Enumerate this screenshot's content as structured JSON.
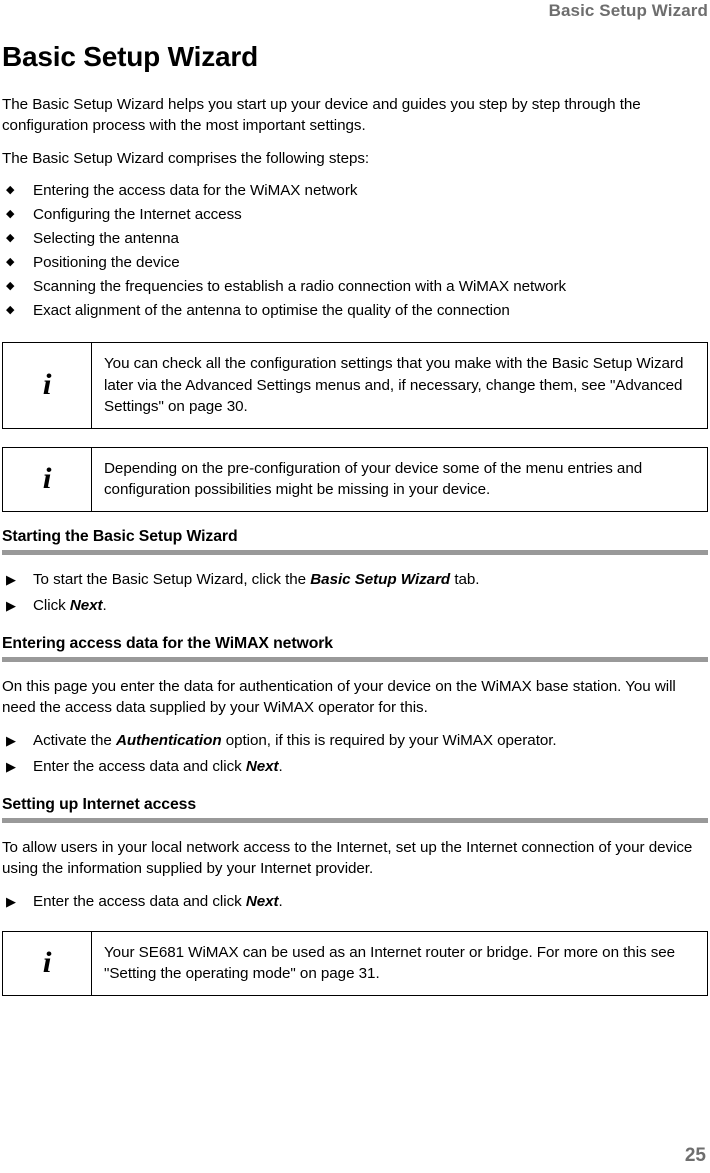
{
  "header": {
    "running_title": "Basic Setup Wizard"
  },
  "footer": {
    "page_number": "25"
  },
  "colors": {
    "heading_rule": "#999999",
    "header_text": "#6e6e6e",
    "body_text": "#000000"
  },
  "icons": {
    "diamond_bullet": "◆",
    "triangle_bullet": "▶",
    "info_letter": "i"
  },
  "main": {
    "title": "Basic Setup Wizard",
    "intro_paragraph_1": "The Basic Setup Wizard helps you start up your device and guides you step by step through the configuration process with the most important settings.",
    "intro_paragraph_2": "The Basic Setup Wizard comprises the following steps:",
    "steps_list": [
      "Entering the access data for the WiMAX network",
      "Configuring the Internet access",
      "Selecting the antenna",
      "Positioning the device",
      "Scanning the frequencies to establish a radio connection with a WiMAX network",
      "Exact alignment of the antenna to optimise the quality of the connection"
    ],
    "note_1": "You can check all the configuration settings that you make with the Basic Setup Wizard later via the Advanced Settings menus and, if necessary, change them, see \"Advanced Settings\" on page 30.",
    "note_2": "Depending on the pre-configuration of your device some of the menu entries and configuration possibilities might be missing in your device.",
    "section_starting": {
      "heading": "Starting the Basic Setup Wizard",
      "step_1_pre": "To start the Basic Setup Wizard, click the ",
      "step_1_bold": "Basic Setup Wizard",
      "step_1_post": " tab.",
      "step_2_pre": "Click ",
      "step_2_bold": "Next",
      "step_2_post": "."
    },
    "section_entering": {
      "heading": "Entering access data for the WiMAX network",
      "paragraph": "On this page you enter the data for authentication of your device on the WiMAX base station. You will need the access data supplied by your WiMAX operator for this.",
      "step_1_pre": "Activate the ",
      "step_1_bold": "Authentication",
      "step_1_post": " option, if this is required by your WiMAX operator.",
      "step_2_pre": "Enter the access data and click ",
      "step_2_bold": "Next",
      "step_2_post": "."
    },
    "section_internet": {
      "heading": "Setting up Internet access",
      "paragraph": "To allow users in your local network access to the Internet, set up the Internet connection of your device using the information supplied by your Internet provider.",
      "step_1_pre": "Enter the access data and click ",
      "step_1_bold": "Next",
      "step_1_post": "."
    },
    "note_3": "Your SE681 WiMAX can be used as an Internet router or bridge. For more on this see \"Setting the operating mode\" on page 31."
  }
}
